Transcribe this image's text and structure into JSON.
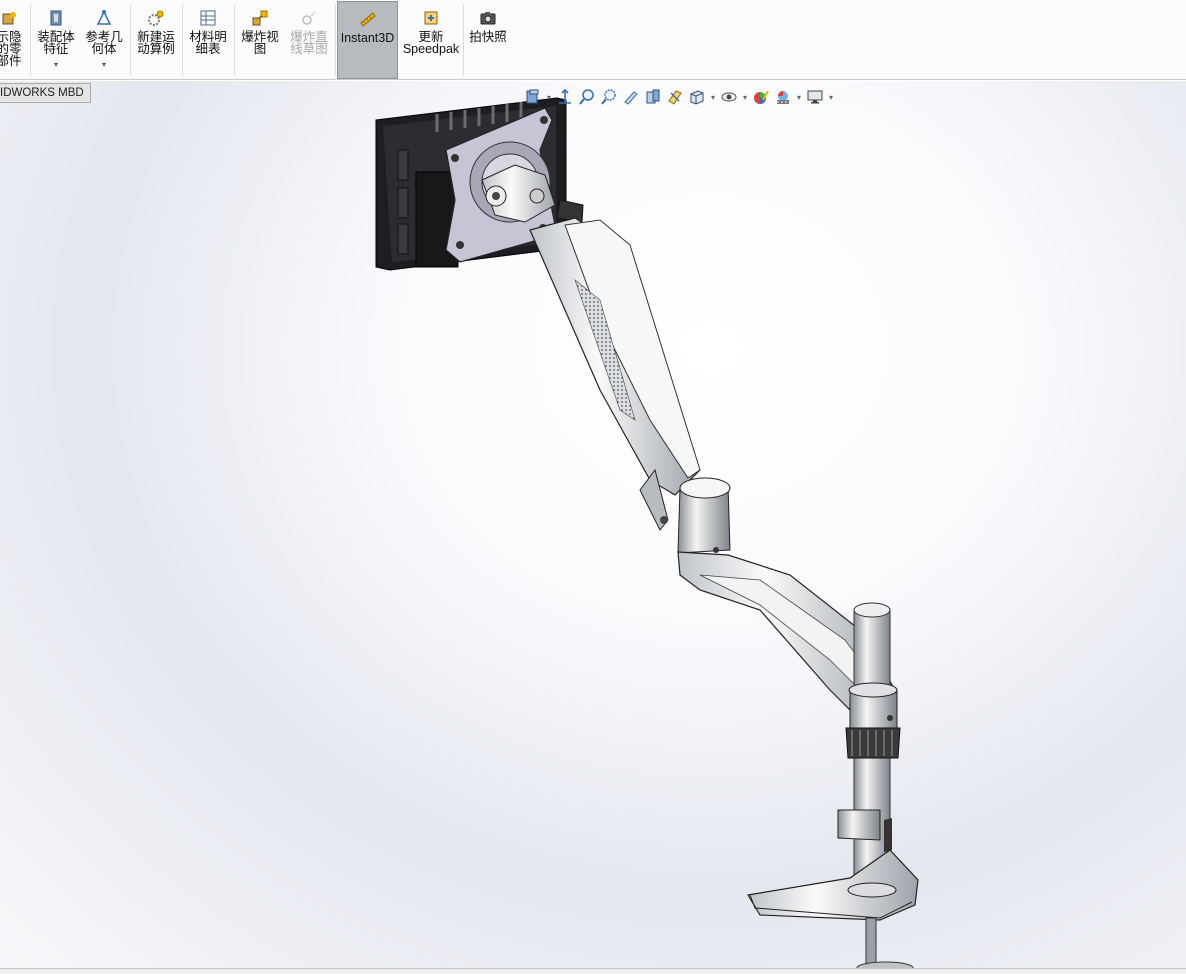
{
  "ribbon": {
    "items": [
      {
        "label": "示隐\n的零\n部件",
        "icon": "show-hidden-components-icon"
      },
      {
        "label": "装配体\n特征",
        "icon": "assembly-features-icon",
        "caret": "▾"
      },
      {
        "label": "参考几\n何体",
        "icon": "reference-geometry-icon",
        "caret": "▾"
      },
      {
        "label": "新建运\n动算例",
        "icon": "new-motion-study-icon"
      },
      {
        "label": "材料明\n细表",
        "icon": "bill-of-materials-icon"
      },
      {
        "label": "爆炸视\n图",
        "icon": "exploded-view-icon"
      },
      {
        "label": "爆炸直\n线草图",
        "icon": "explode-line-sketch-icon"
      },
      {
        "label": "Instant3D",
        "icon": "instant3d-icon"
      },
      {
        "label": "更新\nSpeedpak",
        "icon": "update-speedpak-icon"
      },
      {
        "label": "拍快照",
        "icon": "take-snapshot-icon"
      }
    ]
  },
  "tabs": {
    "mbd": "IDWORKS MBD"
  },
  "hud": {
    "icons": [
      "view-orientation-icon",
      "zoom-to-fit-icon",
      "zoom-to-area-icon",
      "previous-view-icon",
      "section-view-icon",
      "dynamic-annotation-icon",
      "view-orientation-cube-icon",
      "display-style-icon",
      "hide-show-items-icon",
      "edit-appearance-icon",
      "apply-scene-icon",
      "view-settings-icon"
    ]
  },
  "colors": {
    "accent": "#f2b600",
    "active": "#b7bbc0"
  }
}
